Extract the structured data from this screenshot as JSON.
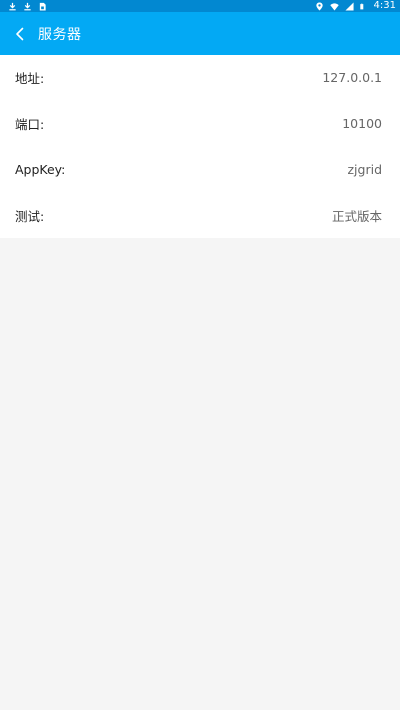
{
  "status_bar": {
    "time": "4:31",
    "left_icons": [
      "download-icon",
      "download-icon",
      "sim-icon"
    ],
    "right_icons": [
      "location-icon",
      "wifi-icon",
      "signal-icon",
      "battery-icon"
    ]
  },
  "app_bar": {
    "title": "服务器",
    "back_icon": "chevron-left-icon",
    "color": "#03a9f4"
  },
  "settings": [
    {
      "label": "地址:",
      "value": "127.0.0.1"
    },
    {
      "label": "端口:",
      "value": "10100"
    },
    {
      "label": "AppKey:",
      "value": "zjgrid"
    },
    {
      "label": "测试:",
      "value": "正式版本"
    }
  ]
}
